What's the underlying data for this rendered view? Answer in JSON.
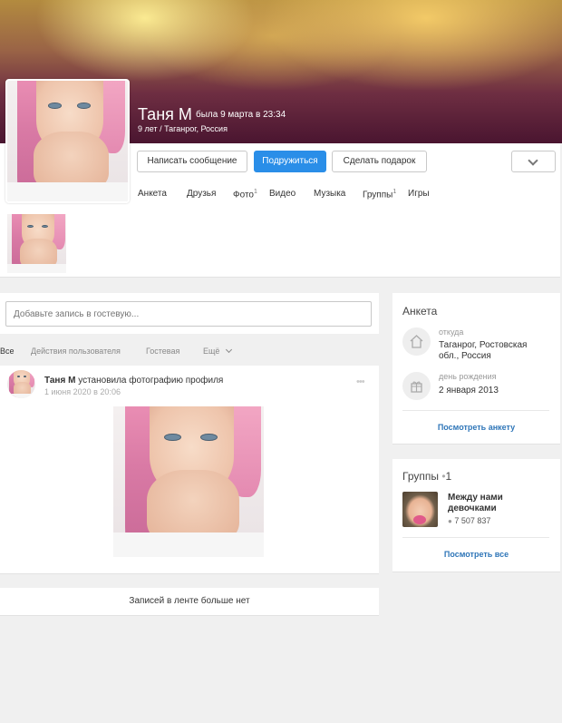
{
  "profile": {
    "name": "Таня М",
    "last_seen": "была 9 марта в 23:34",
    "subtitle": "9 лет / Таганрог, Россия"
  },
  "actions": {
    "message": "Написать сообщение",
    "befriend": "Подружиться",
    "gift": "Сделать подарок"
  },
  "nav": {
    "items": [
      {
        "label": "Анкета",
        "count": ""
      },
      {
        "label": "Друзья",
        "count": ""
      },
      {
        "label": "Фото",
        "count": "1"
      },
      {
        "label": "Видео",
        "count": ""
      },
      {
        "label": "Музыка",
        "count": ""
      },
      {
        "label": "Группы",
        "count": "1"
      },
      {
        "label": "Игры",
        "count": ""
      }
    ]
  },
  "guestbook": {
    "placeholder": "Добавьте запись в гостевую..."
  },
  "feed_tabs": {
    "all": "Все",
    "user_actions": "Действия пользователя",
    "guest": "Гостевая",
    "more": "Ещё"
  },
  "post": {
    "author": "Таня М",
    "action": "установила фотографию профиля",
    "date": "1 июня 2020 в 20:06",
    "menu": "•••"
  },
  "feed_end": "Записей в ленте больше нет",
  "about": {
    "title": "Анкета",
    "from_label": "откуда",
    "from_value": "Таганрог, Ростовская обл., Россия",
    "birthday_label": "день рождения",
    "birthday_value": "2 января 2013",
    "link": "Посмотреть анкету"
  },
  "groups": {
    "title": "Группы",
    "separator": "•",
    "count": "1",
    "group_name": "Между нами девочками",
    "members": "7 507 837",
    "link": "Посмотреть все"
  },
  "colors": {
    "accent": "#2a8ee8",
    "link": "#2f76b8"
  }
}
